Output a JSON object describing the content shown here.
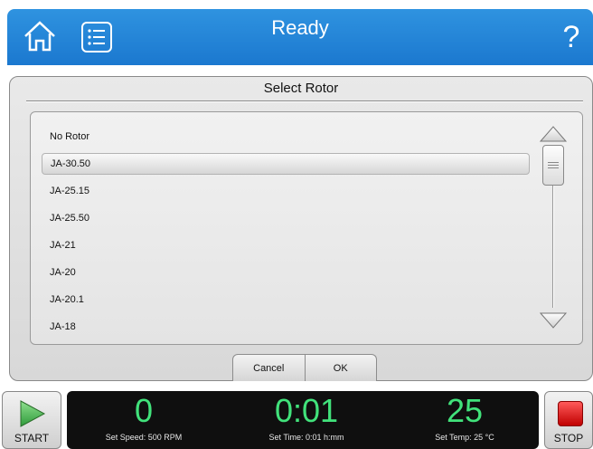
{
  "header": {
    "title": "Ready",
    "help_label": "?"
  },
  "dialog": {
    "title": "Select Rotor",
    "rotors": [
      "No Rotor",
      "JA-30.50",
      "JA-25.15",
      "JA-25.50",
      "JA-21",
      "JA-20",
      "JA-20.1",
      "JA-18"
    ],
    "selected_index": 1,
    "cancel_label": "Cancel",
    "ok_label": "OK"
  },
  "controls": {
    "start_label": "START",
    "stop_label": "STOP"
  },
  "status": {
    "speed_value": "0",
    "speed_label": "Set Speed: 500 RPM",
    "time_value": "0:01",
    "time_label": "Set Time: 0:01 h:mm",
    "temp_value": "25",
    "temp_label": "Set Temp: 25 °C"
  },
  "colors": {
    "header_blue": "#1b78cf",
    "readout_green": "#41e27b",
    "stop_red": "#d61414",
    "start_green": "#4caf50"
  }
}
